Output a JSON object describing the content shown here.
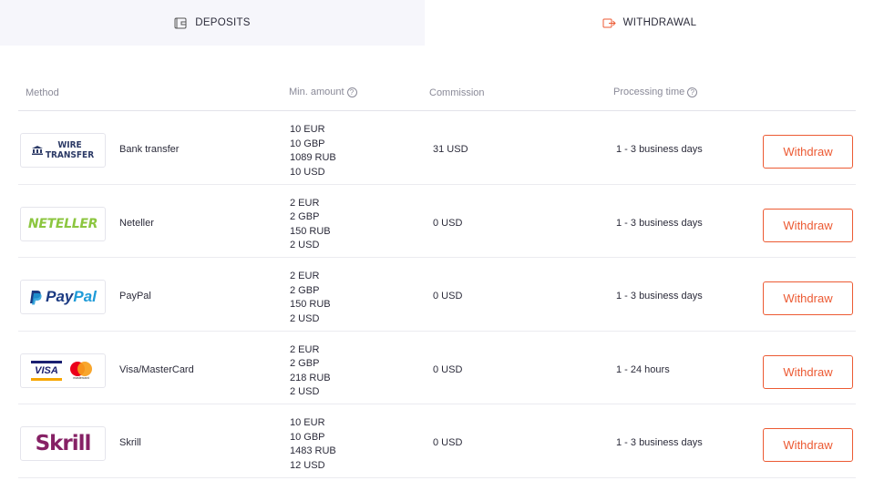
{
  "tabs": [
    {
      "label": "DEPOSITS",
      "icon": "wallet-icon",
      "active": false
    },
    {
      "label": "WITHDRAWAL",
      "icon": "withdraw-arrow-icon",
      "active": true
    }
  ],
  "table": {
    "headers": {
      "method": "Method",
      "min_amount": "Min. amount",
      "commission": "Commission",
      "processing_time": "Processing time"
    },
    "rows": [
      {
        "logo": {
          "line1": "WIRE",
          "line2": "TRANSFER"
        },
        "method": "Bank transfer",
        "amounts": [
          "10 EUR",
          "10 GBP",
          "1089 RUB",
          "10 USD"
        ],
        "commission": "31 USD",
        "processing": "1 - 3 business days",
        "button": "Withdraw"
      },
      {
        "logo": {
          "text": "NETELLER"
        },
        "method": "Neteller",
        "amounts": [
          "2 EUR",
          "2 GBP",
          "150 RUB",
          "2 USD"
        ],
        "commission": "0 USD",
        "processing": "1 - 3 business days",
        "button": "Withdraw"
      },
      {
        "logo": {
          "pay": "Pay",
          "pal": "Pal"
        },
        "method": "PayPal",
        "amounts": [
          "2 EUR",
          "2 GBP",
          "150 RUB",
          "2 USD"
        ],
        "commission": "0 USD",
        "processing": "1 - 3 business days",
        "button": "Withdraw"
      },
      {
        "logo": {
          "visa": "VISA",
          "mc": "mastercard"
        },
        "method": "Visa/MasterCard",
        "amounts": [
          "2 EUR",
          "2 GBP",
          "218 RUB",
          "2 USD"
        ],
        "commission": "0 USD",
        "processing": "1 - 24 hours",
        "button": "Withdraw"
      },
      {
        "logo": {
          "text": "Skrill"
        },
        "method": "Skrill",
        "amounts": [
          "10 EUR",
          "10 GBP",
          "1483 RUB",
          "12 USD"
        ],
        "commission": "0 USD",
        "processing": "1 - 3 business days",
        "button": "Withdraw"
      }
    ]
  },
  "colors": {
    "accent": "#ec5a33",
    "tab_inactive_bg": "#f6f6fb",
    "neteller": "#8cc63f",
    "paypal_dark": "#1b3a82",
    "paypal_light": "#1f9bd8",
    "skrill": "#862165"
  }
}
